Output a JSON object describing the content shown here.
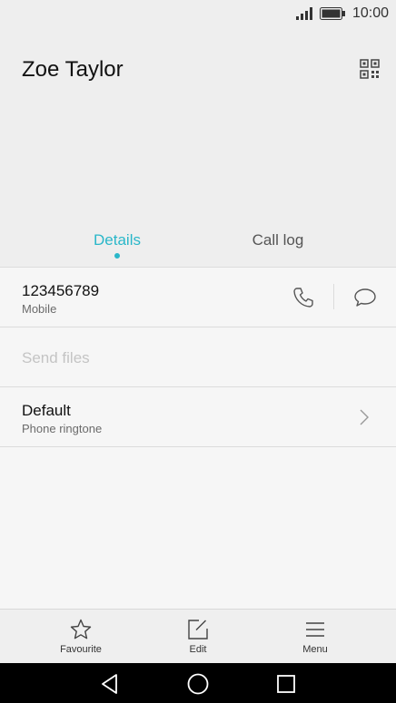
{
  "status_bar": {
    "time": "10:00"
  },
  "contact": {
    "name": "Zoe Taylor"
  },
  "tabs": [
    {
      "label": "Details",
      "active": true
    },
    {
      "label": "Call log",
      "active": false
    }
  ],
  "rows": {
    "number": {
      "value": "123456789",
      "type": "Mobile"
    },
    "send_files": {
      "label": "Send files"
    },
    "ringtone": {
      "value": "Default",
      "label": "Phone ringtone"
    }
  },
  "bottom_bar": [
    {
      "label": "Favourite",
      "icon": "star-icon"
    },
    {
      "label": "Edit",
      "icon": "edit-icon"
    },
    {
      "label": "Menu",
      "icon": "menu-icon"
    }
  ],
  "colors": {
    "accent": "#2ab7c9",
    "header_bg": "#eeeeee",
    "page_bg": "#f6f6f6"
  }
}
